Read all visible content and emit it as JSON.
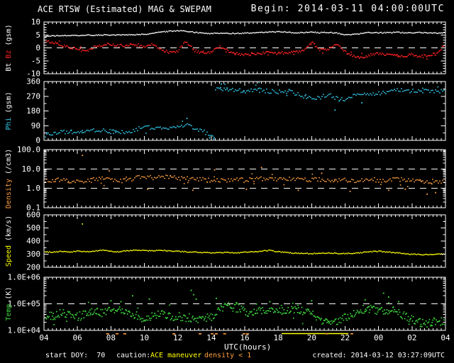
{
  "title": {
    "left": "ACE RTSW (Estimated) MAG & SWEPAM",
    "right": "Begin: 2014-03-11 04:00:00UTC"
  },
  "footer": {
    "start_doy": "start DOY:  70",
    "caution_label": "caution:",
    "caution_maneuver": "ACE maneuver",
    "caution_density": "density < 1",
    "created": "created: 2014-03-12 03:27:09UTC"
  },
  "xaxis": {
    "label": "UTC(hours)",
    "range": [
      4,
      28
    ],
    "tick_hours": [
      4,
      6,
      8,
      10,
      12,
      14,
      16,
      18,
      20,
      22,
      24,
      26,
      28
    ],
    "tick_labels": [
      "04",
      "06",
      "08",
      "10",
      "12",
      "14",
      "16",
      "18",
      "20",
      "22",
      "00",
      "02",
      "04"
    ],
    "minor_step": 0.25,
    "major_step": 2
  },
  "colors": {
    "background": "#000000",
    "axis": "#ffffff",
    "bt": "#ffffff",
    "bz": "#ff2222",
    "phi": "#33ccee",
    "density": "#ff9f40",
    "speed": "#ffff00",
    "temp": "#3dd43d",
    "maneuver_bar": "#ffff00"
  },
  "chart_data": {
    "type": "line",
    "title": "ACE RTSW (Estimated) MAG & SWEPAM",
    "x_unit": "UTC hours from 2014-03-11 04:00 to 2014-03-12 04:00",
    "x_start": 4,
    "x_step": 0.5,
    "annotations": {
      "maneuver_bar_hours": [
        18.2,
        22.2
      ],
      "density_flag_hours": [
        7.8,
        8.37,
        8.83,
        11.76,
        13.33,
        14.05,
        14.3,
        14.8,
        15.96,
        16.17,
        20.9,
        22.4
      ]
    },
    "panels": [
      {
        "name": "mag",
        "scale": "linear",
        "ylim": [
          -10,
          10
        ],
        "minor_step": 1,
        "major_step": 5,
        "dashed": [
          0
        ],
        "yticks": [
          {
            "label": "10",
            "v": 10
          },
          {
            "label": "5",
            "v": 5
          },
          {
            "label": "0",
            "v": 0
          },
          {
            "label": "-5",
            "v": -5
          },
          {
            "label": "-10",
            "v": -10
          }
        ],
        "ylabel": [
          {
            "text": "Bt ",
            "color": "#ffffff"
          },
          {
            "text": "Bz",
            "color": "#ff2222"
          },
          {
            "text": " (gsm)",
            "color": "#ffffff"
          }
        ],
        "series": [
          {
            "name": "Bt",
            "color": "#ffffff",
            "style": "tight",
            "values": [
              4.4,
              4.6,
              4.7,
              4.8,
              4.8,
              4.9,
              4.9,
              5.0,
              5.0,
              5.0,
              5.0,
              5.1,
              5.2,
              5.6,
              6.1,
              6.4,
              6.6,
              6.4,
              6.0,
              5.6,
              5.5,
              5.7,
              5.5,
              5.6,
              5.7,
              5.8,
              6.0,
              6.1,
              6.2,
              6.1,
              5.8,
              5.9,
              6.1,
              5.8,
              6.0,
              5.7,
              5.0,
              5.1,
              5.6,
              5.9,
              5.8,
              5.9,
              6.0,
              5.9,
              5.8,
              5.9,
              5.8,
              5.7,
              5.8
            ]
          },
          {
            "name": "Bz",
            "color": "#ff2222",
            "style": "loose",
            "values": [
              3.0,
              2.0,
              1.0,
              0.3,
              -0.5,
              -1.4,
              0.3,
              1.2,
              1.5,
              0.8,
              1.1,
              1.3,
              0.4,
              1.4,
              -0.6,
              -1.8,
              -1.4,
              2.6,
              -1.2,
              -1.9,
              -1.6,
              0.4,
              -1.1,
              -2.3,
              -2.6,
              -2.4,
              -2.1,
              -1.9,
              -2.1,
              -1.8,
              -1.6,
              -1.4,
              2.2,
              -0.9,
              -0.4,
              1.6,
              -1.5,
              -3.4,
              -3.7,
              -2.8,
              -2.2,
              -2.5,
              -2.9,
              -3.3,
              -2.6,
              -3.4,
              -2.9,
              -2.2,
              1.8
            ]
          }
        ]
      },
      {
        "name": "phi",
        "scale": "linear",
        "ylim": [
          0,
          360
        ],
        "minor_step": 45,
        "major_step": 90,
        "dashed": [],
        "yticks": [
          {
            "label": "360",
            "v": 360
          },
          {
            "label": "270",
            "v": 270
          },
          {
            "label": "180",
            "v": 180
          },
          {
            "label": "90",
            "v": 90
          },
          {
            "label": "0",
            "v": 0
          }
        ],
        "ylabel": [
          {
            "text": "Phi ",
            "color": "#33ccee"
          },
          {
            "text": "(gsm)",
            "color": "#ffffff"
          }
        ],
        "series": [
          {
            "name": "Phi",
            "color": "#33ccee",
            "style": "scatter",
            "jump_threshold": 150,
            "values": [
              25,
              40,
              48,
              52,
              55,
              57,
              60,
              60,
              52,
              47,
              52,
              68,
              85,
              75,
              68,
              75,
              85,
              92,
              78,
              55,
              30,
              320,
              310,
              304,
              300,
              308,
              304,
              300,
              296,
              300,
              290,
              268,
              252,
              262,
              278,
              256,
              246,
              268,
              280,
              286,
              290,
              298,
              306,
              303,
              300,
              302,
              300,
              296,
              300
            ],
            "outliers": [
              [
                12.55,
                135
              ],
              [
                13.9,
                15
              ],
              [
                14.15,
                8
              ],
              [
                14.6,
                345
              ],
              [
                16.85,
                355
              ],
              [
                21.4,
                185
              ],
              [
                23.0,
                230
              ]
            ]
          }
        ]
      },
      {
        "name": "density",
        "scale": "log",
        "ylim": [
          0.1,
          100
        ],
        "dashed": [
          10,
          1
        ],
        "yticks": [
          {
            "label": "100.0",
            "v": 100
          },
          {
            "label": "10.0",
            "v": 10
          },
          {
            "label": "1.0",
            "v": 1
          },
          {
            "label": "0.1",
            "v": 0.1
          }
        ],
        "ylabel": [
          {
            "text": "Density ",
            "color": "#ff9f40"
          },
          {
            "text": "(/cm3)",
            "color": "#ffffff"
          }
        ],
        "series": [
          {
            "name": "Density",
            "color": "#ff9f40",
            "style": "band",
            "values": [
              2.2,
              2.5,
              2.8,
              2.4,
              2.6,
              2.3,
              2.8,
              3.0,
              2.6,
              2.4,
              2.8,
              3.2,
              4.2,
              3.5,
              3.8,
              3.6,
              3.4,
              3.3,
              3.2,
              2.8,
              2.6,
              2.4,
              2.8,
              3.0,
              2.6,
              2.9,
              3.1,
              3.3,
              3.0,
              2.8,
              3.2,
              3.0,
              2.8,
              2.7,
              2.6,
              2.5,
              2.6,
              2.4,
              2.7,
              2.9,
              2.6,
              2.8,
              3.0,
              2.7,
              2.5,
              2.3,
              2.4,
              2.2,
              2.3
            ],
            "outliers": [
              [
                6.3,
                50
              ],
              [
                7.9,
                8
              ],
              [
                10.2,
                0.9
              ],
              [
                12.9,
                0.8
              ],
              [
                14.2,
                9
              ],
              [
                16.1,
                0.9
              ],
              [
                17.0,
                12
              ],
              [
                19.2,
                0.8
              ],
              [
                20.6,
                6
              ],
              [
                22.3,
                0.7
              ],
              [
                24.6,
                0.8
              ],
              [
                25.6,
                0.9
              ],
              [
                26.9,
                0.5
              ],
              [
                27.4,
                0.6
              ]
            ]
          }
        ]
      },
      {
        "name": "speed",
        "scale": "linear",
        "ylim": [
          200,
          600
        ],
        "minor_step": 50,
        "major_step": 100,
        "dashed": [],
        "yticks": [
          {
            "label": "600",
            "v": 600
          },
          {
            "label": "500",
            "v": 500
          },
          {
            "label": "400",
            "v": 400
          },
          {
            "label": "300",
            "v": 300
          },
          {
            "label": "200",
            "v": 200
          }
        ],
        "ylabel": [
          {
            "text": "Speed ",
            "color": "#ffff00"
          },
          {
            "text": "(km/s)",
            "color": "#ffffff"
          }
        ],
        "series": [
          {
            "name": "Speed",
            "color": "#ffff00",
            "style": "tight",
            "values": [
              318,
              315,
              320,
              316,
              322,
              318,
              325,
              330,
              322,
              318,
              326,
              331,
              328,
              325,
              330,
              326,
              322,
              318,
              315,
              312,
              310,
              314,
              312,
              310,
              315,
              318,
              322,
              330,
              318,
              312,
              308,
              306,
              305,
              306,
              308,
              306,
              305,
              308,
              312,
              318,
              322,
              316,
              310,
              305,
              300,
              297,
              296,
              300,
              302
            ],
            "outliers": [
              [
                6.3,
                530
              ]
            ]
          }
        ]
      },
      {
        "name": "temp",
        "scale": "log",
        "ylim": [
          10000,
          1000000
        ],
        "dashed": [
          100000
        ],
        "yticks": [
          {
            "label": "1.0E+06",
            "v": 1000000
          },
          {
            "label": "1.0E+05",
            "v": 100000
          },
          {
            "label": "1.0E+04",
            "v": 10000
          }
        ],
        "ylabel": [
          {
            "text": "Temp ",
            "color": "#3dd43d"
          },
          {
            "text": "(K)",
            "color": "#ffffff"
          }
        ],
        "series": [
          {
            "name": "Temp",
            "color": "#3dd43d",
            "style": "cloud",
            "values": [
              40000,
              35000,
              45000,
              38000,
              32000,
              42000,
              50000,
              45000,
              55000,
              60000,
              45000,
              35000,
              28000,
              35000,
              40000,
              36000,
              32000,
              30000,
              28000,
              26000,
              32000,
              60000,
              80000,
              70000,
              50000,
              45000,
              55000,
              60000,
              65000,
              60000,
              55000,
              50000,
              40000,
              20000,
              18000,
              22000,
              30000,
              45000,
              60000,
              65000,
              55000,
              60000,
              50000,
              35000,
              25000,
              20000,
              18000,
              22000,
              20000
            ],
            "outliers": [
              [
                8.0,
                130000
              ],
              [
                8.6,
                120000
              ],
              [
                9.3,
                200000
              ],
              [
                10.3,
                150000
              ],
              [
                12.8,
                320000
              ],
              [
                12.95,
                220000
              ],
              [
                13.1,
                150000
              ],
              [
                14.3,
                160000
              ],
              [
                15.5,
                110000
              ],
              [
                17.5,
                120000
              ],
              [
                20.0,
                130000
              ],
              [
                23.2,
                140000
              ],
              [
                24.3,
                250000
              ],
              [
                24.6,
                180000
              ],
              [
                25.2,
                120000
              ],
              [
                26.5,
                14000
              ],
              [
                27.2,
                15000
              ]
            ]
          }
        ]
      }
    ]
  }
}
